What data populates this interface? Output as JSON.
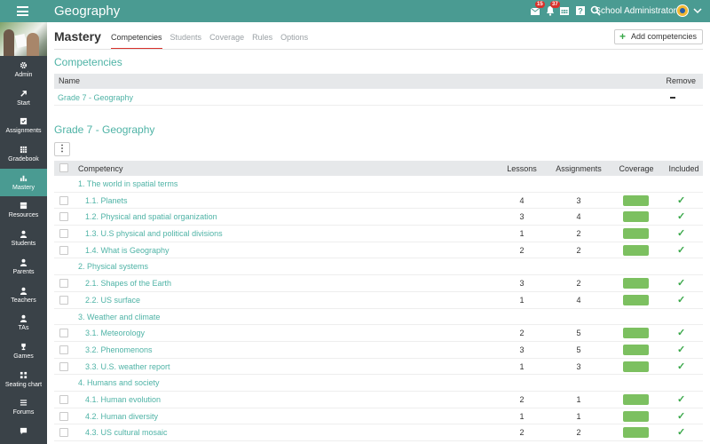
{
  "app": {
    "title": "Geography",
    "user_name": "School Administrator",
    "notifications": {
      "messages_count": "15",
      "alerts_count": "37"
    }
  },
  "sidebar": {
    "items": [
      {
        "label": "Admin",
        "icon": "gear-icon",
        "active": false
      },
      {
        "label": "Start",
        "icon": "arrow-icon",
        "active": false
      },
      {
        "label": "Assignments",
        "icon": "checklist-icon",
        "active": false
      },
      {
        "label": "Gradebook",
        "icon": "table-icon",
        "active": false
      },
      {
        "label": "Mastery",
        "icon": "bar-chart-icon",
        "active": true
      },
      {
        "label": "Resources",
        "icon": "calendar-icon",
        "active": false
      },
      {
        "label": "Students",
        "icon": "person-icon",
        "active": false
      },
      {
        "label": "Parents",
        "icon": "person-icon",
        "active": false
      },
      {
        "label": "Teachers",
        "icon": "person-icon",
        "active": false
      },
      {
        "label": "TAs",
        "icon": "person-icon",
        "active": false
      },
      {
        "label": "Games",
        "icon": "trophy-icon",
        "active": false
      },
      {
        "label": "Seating chart",
        "icon": "grid-icon",
        "active": false
      },
      {
        "label": "Forums",
        "icon": "list-icon",
        "active": false
      }
    ]
  },
  "page": {
    "title": "Mastery",
    "tabs": [
      "Competencies",
      "Students",
      "Coverage",
      "Rules",
      "Options"
    ],
    "active_tab": "Competencies",
    "add_button": "Add competencies"
  },
  "competencies": {
    "title": "Competencies",
    "header_name": "Name",
    "header_remove": "Remove",
    "rows": [
      {
        "name": "Grade 7 - Geography"
      }
    ]
  },
  "grade": {
    "title": "Grade 7 - Geography",
    "headers": {
      "competency": "Competency",
      "lessons": "Lessons",
      "assignments": "Assignments",
      "coverage": "Coverage",
      "included": "Included"
    },
    "rows": [
      {
        "type": "group",
        "name": "1. The world in spatial terms"
      },
      {
        "type": "sub",
        "name": "1.1. Planets",
        "lessons": "4",
        "assignments": "3"
      },
      {
        "type": "sub",
        "name": "1.2. Physical and spatial organization",
        "lessons": "3",
        "assignments": "4"
      },
      {
        "type": "sub",
        "name": "1.3. U.S physical and political divisions",
        "lessons": "1",
        "assignments": "2"
      },
      {
        "type": "sub",
        "name": "1.4. What is Geography",
        "lessons": "2",
        "assignments": "2"
      },
      {
        "type": "group",
        "name": "2. Physical systems"
      },
      {
        "type": "sub",
        "name": "2.1. Shapes of the Earth",
        "lessons": "3",
        "assignments": "2"
      },
      {
        "type": "sub",
        "name": "2.2. US surface",
        "lessons": "1",
        "assignments": "4"
      },
      {
        "type": "group",
        "name": "3. Weather and climate"
      },
      {
        "type": "sub",
        "name": "3.1. Meteorology",
        "lessons": "2",
        "assignments": "5"
      },
      {
        "type": "sub",
        "name": "3.2. Phenomenons",
        "lessons": "3",
        "assignments": "5"
      },
      {
        "type": "sub",
        "name": "3.3. U.S. weather report",
        "lessons": "1",
        "assignments": "3"
      },
      {
        "type": "group",
        "name": "4. Humans and society"
      },
      {
        "type": "sub",
        "name": "4.1. Human evolution",
        "lessons": "2",
        "assignments": "1"
      },
      {
        "type": "sub",
        "name": "4.2. Human diversity",
        "lessons": "1",
        "assignments": "1"
      },
      {
        "type": "sub",
        "name": "4.3. US cultural mosaic",
        "lessons": "2",
        "assignments": "2"
      }
    ]
  },
  "colors": {
    "topbar": "#4a9b92",
    "sidebar": "#3a4248",
    "link": "#4fb3a6",
    "coverage": "#7cc060",
    "check": "#3aa84a",
    "tab_underline": "#d9312b"
  }
}
